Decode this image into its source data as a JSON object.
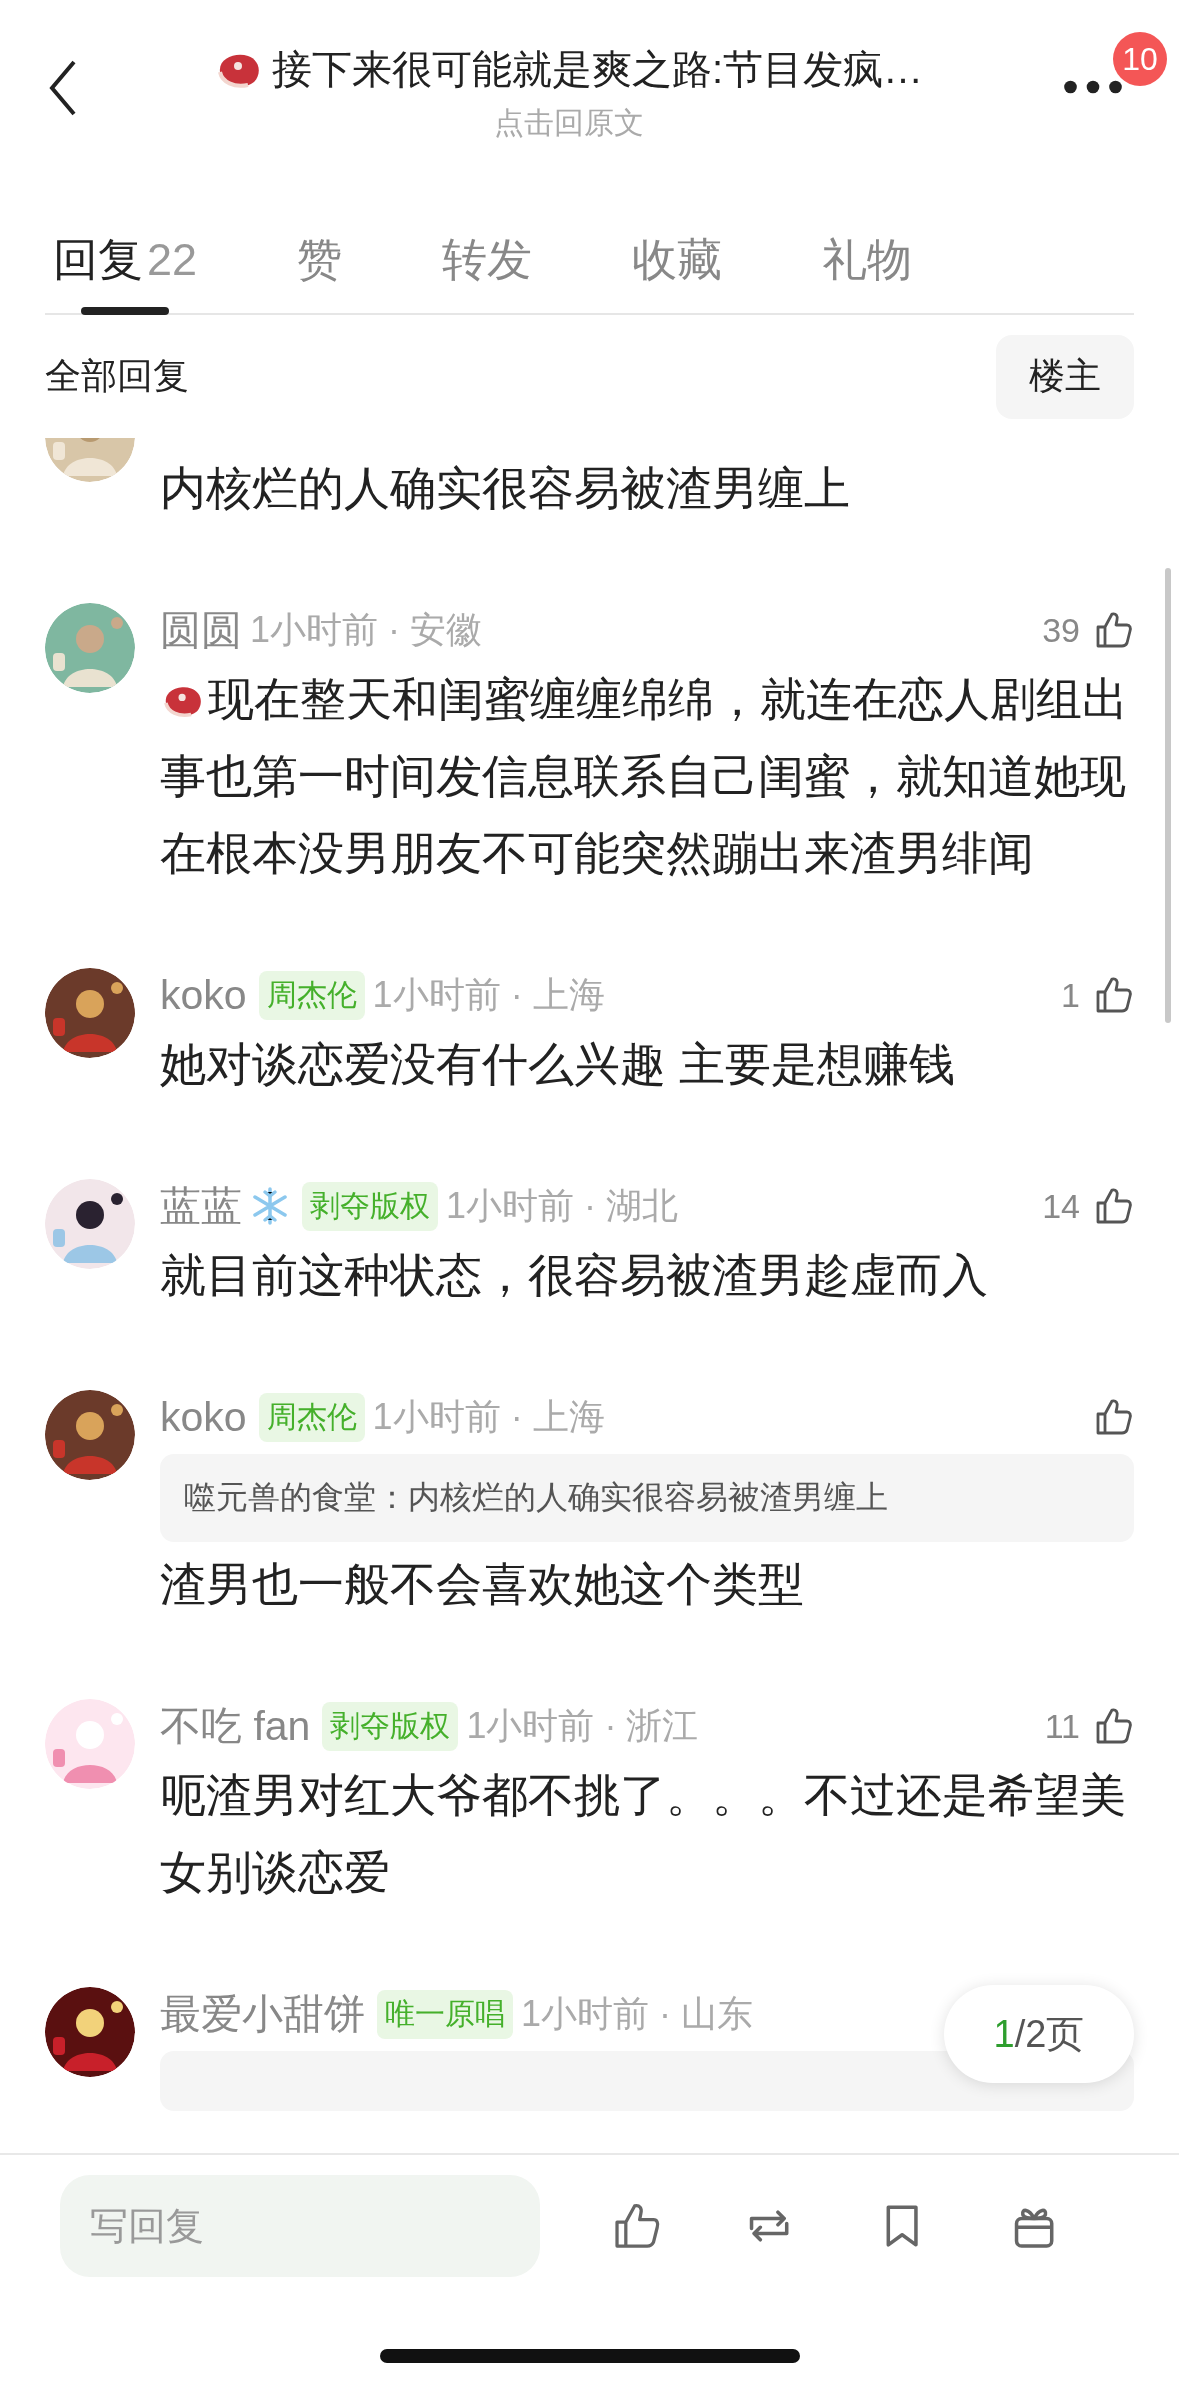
{
  "header": {
    "title": "接下来很可能就是爽之路:节目发疯…",
    "subtitle": "点击回原文",
    "badge": "10"
  },
  "tabs": [
    {
      "label": "回复",
      "count": "22",
      "selected": true
    },
    {
      "label": "赞",
      "selected": false
    },
    {
      "label": "转发",
      "selected": false
    },
    {
      "label": "收藏",
      "selected": false
    },
    {
      "label": "礼物",
      "selected": false
    }
  ],
  "filter": {
    "label": "全部回复",
    "button": "楼主"
  },
  "comments": [
    {
      "kind": "cut-top",
      "text": "内核烂的人确实很容易被渣男缠上"
    },
    {
      "kind": "full",
      "name": "圆圆",
      "meta": "1小时前 · 安徽",
      "likes": "39",
      "sticker": true,
      "text": "现在整天和闺蜜缠缠绵绵，就连在恋人剧组出事也第一时间发信息联系自己闺蜜，就知道她现在根本没男朋友不可能突然蹦出来渣男绯闻"
    },
    {
      "kind": "full",
      "name": "koko",
      "badge": "周杰伦",
      "meta": "1小时前 · 上海",
      "likes": "1",
      "text": "她对谈恋爱没有什么兴趣 主要是想赚钱"
    },
    {
      "kind": "full",
      "name": "蓝蓝",
      "flair": true,
      "badge": "剥夺版权",
      "meta": "1小时前 · 湖北",
      "likes": "14",
      "text": "就目前这种状态，很容易被渣男趁虚而入"
    },
    {
      "kind": "full",
      "name": "koko",
      "badge": "周杰伦",
      "meta": "1小时前 · 上海",
      "quote": "噬元兽的食堂：内核烂的人确实很容易被渣男缠上",
      "text": "渣男也一般不会喜欢她这个类型"
    },
    {
      "kind": "full",
      "name": "不吃 fan",
      "badge": "剥夺版权",
      "meta": "1小时前 · 浙江",
      "likes": "11",
      "text": "呃渣男对红大爷都不挑了。。。不过还是希望美女别谈恋爱"
    },
    {
      "kind": "cut-bottom",
      "name": "最爱小甜饼",
      "badge": "唯一原唱",
      "meta": "1小时前 · 山东"
    }
  ],
  "pager": {
    "current": "1",
    "rest": "/2页"
  },
  "reply_box": {
    "placeholder": "写回复"
  }
}
